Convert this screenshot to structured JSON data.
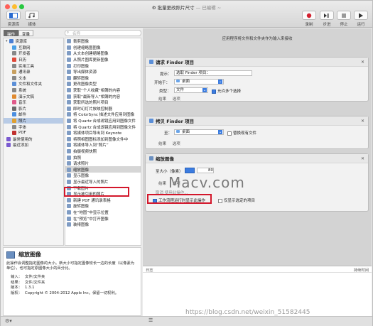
{
  "window": {
    "title": "批量更改照片尺寸",
    "title_suffix": "— 已编辑 ~"
  },
  "toolbar": {
    "left": [
      {
        "label": "资源库",
        "icon": "library-icon"
      },
      {
        "label": "媒体",
        "icon": "media-icon"
      }
    ],
    "right": [
      {
        "label": "录制",
        "icon": "record-icon"
      },
      {
        "label": "步进",
        "icon": "step-icon"
      },
      {
        "label": "停止",
        "icon": "stop-icon"
      },
      {
        "label": "运行",
        "icon": "run-icon"
      }
    ]
  },
  "tabs": [
    "操作",
    "变量"
  ],
  "search": {
    "placeholder": "名称"
  },
  "library": {
    "items": [
      {
        "label": "资源库",
        "color": "#4a7fd4"
      },
      {
        "label": "互联网",
        "color": "#4aa0e6"
      },
      {
        "label": "开发者",
        "color": "#888888"
      },
      {
        "label": "日历",
        "color": "#e04a3a"
      },
      {
        "label": "实用工具",
        "color": "#888888"
      },
      {
        "label": "通讯录",
        "color": "#c8a060"
      },
      {
        "label": "文本",
        "color": "#888888"
      },
      {
        "label": "文件和文件夹",
        "color": "#5b8fd8"
      },
      {
        "label": "系统",
        "color": "#888888"
      },
      {
        "label": "演示文稿",
        "color": "#e08a30"
      },
      {
        "label": "音乐",
        "color": "#e05a8a"
      },
      {
        "label": "影片",
        "color": "#6a6a6a"
      },
      {
        "label": "邮件",
        "color": "#4a8ee0"
      },
      {
        "label": "照片",
        "color": "#e0a030"
      },
      {
        "label": "字体",
        "color": "#888888"
      },
      {
        "label": "PDF",
        "color": "#c03030"
      },
      {
        "label": "最常使用的",
        "color": "#7a5ad0"
      },
      {
        "label": "最近添加",
        "color": "#7a5ad0"
      }
    ],
    "selected": 13
  },
  "actions": {
    "items": [
      "裁剪图像",
      "创建缩略图图像",
      "从文本创建缩略图像",
      "从照片图库更新图像",
      "打印图像",
      "导出媒体资源",
      "翻转图像",
      "更改图像类型",
      "获取“个人收藏”相簿的内容",
      "获取“最新导入”相簿的内容",
      "获取所选的照片项目",
      "即时幻灯片放映控制器",
      "将 ColorSync 描述文件应用到图像",
      "将 Quartz 合成滤镜应用到图像文件",
      "将 Quartz 合成滤镜应用到图像文件",
      "将媒体项目导出到 Keynote",
      "将照相图图标添加到图像文件中",
      "将媒体导入到“照片”",
      "拍摄视频快照",
      "拍照",
      "请求照片",
      "缩放图像",
      "显示图像",
      "显示最近导入的照片",
      "下载图片",
      "显示被引用的照片",
      "新建 PDF 通讯录表格",
      "旋转图像",
      "在“地图”中显示位置",
      "在“预览”中打开图像",
      "装裱图像"
    ],
    "selected": 21
  },
  "description": {
    "title": "缩放图像",
    "text": "此操作会调整指定图像的大小。新大小可指定图像较长一边的长度（以像素为单位），也可指定原图像大小的百分比。",
    "input_label": "输入：",
    "input_value": "文件/文件夹",
    "result_label": "结果：",
    "result_value": "文件/文件夹",
    "version_label": "版本：",
    "version_value": "1.3.1",
    "copyright_label": "版权：",
    "copyright_value": "Copyright © 2004-2012 Apple Inc。保留一切权利。"
  },
  "workflow": {
    "hint": "应用程序将文件和文件夹作为输入来接收",
    "cards": [
      {
        "title": "请求 Finder 项目",
        "prompt_label": "提示：",
        "prompt_value": "选取 Finder 项目：",
        "start_label": "开始于：",
        "start_value": "桌面",
        "type_label": "类型：",
        "type_value": "文件",
        "allow_multiple": "允许多个选择",
        "tabs": [
          "结果",
          "选项"
        ]
      },
      {
        "title": "拷贝 Finder 项目",
        "to_label": "至：",
        "to_value": "桌面",
        "replace": "替换现有文件",
        "tabs": [
          "结果",
          "选项"
        ]
      },
      {
        "title": "缩放图像",
        "size_label": "至大小（像素）",
        "size_value": "80",
        "tabs": [
          "结果",
          "选项"
        ],
        "extra_text": "取消 使用此操作...",
        "option1": "工作流程运行时显示此操作",
        "option2": "仅显示选定的项目"
      }
    ]
  },
  "log": {
    "header_left": "日志",
    "header_right": "持续时间"
  },
  "watermark": {
    "brand": "Macv.com",
    "url": "https://blog.csdn.net/weixin_51582445"
  },
  "accent": "#3b7ce0",
  "highlight": "#d3172b"
}
